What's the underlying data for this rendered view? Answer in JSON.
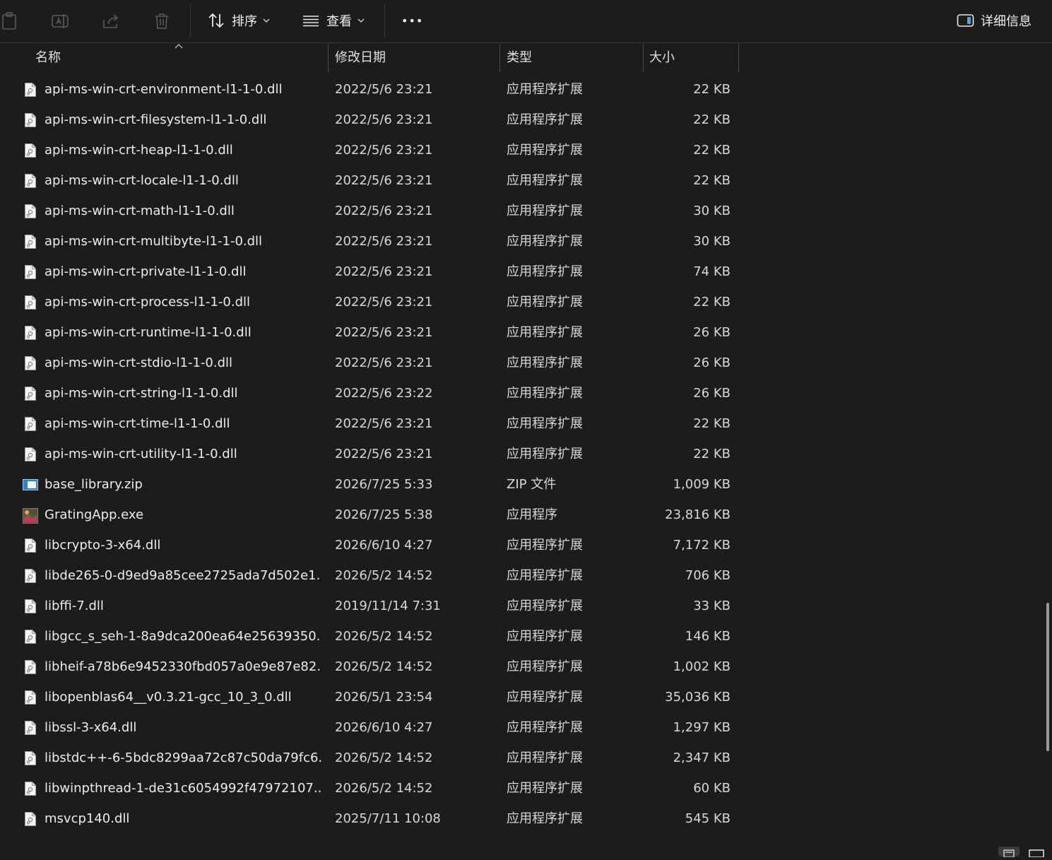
{
  "toolbar": {
    "sort_label": "排序",
    "view_label": "查看",
    "more_label": "•••",
    "details_label": "详细信息"
  },
  "columns": {
    "name": "名称",
    "date": "修改日期",
    "type": "类型",
    "size": "大小"
  },
  "files": [
    {
      "name": "api-ms-win-crt-environment-l1-1-0.dll",
      "date": "2022/5/6 23:21",
      "type": "应用程序扩展",
      "size": "22 KB",
      "icon": "dll-file-icon"
    },
    {
      "name": "api-ms-win-crt-filesystem-l1-1-0.dll",
      "date": "2022/5/6 23:21",
      "type": "应用程序扩展",
      "size": "22 KB",
      "icon": "dll-file-icon"
    },
    {
      "name": "api-ms-win-crt-heap-l1-1-0.dll",
      "date": "2022/5/6 23:21",
      "type": "应用程序扩展",
      "size": "22 KB",
      "icon": "dll-file-icon"
    },
    {
      "name": "api-ms-win-crt-locale-l1-1-0.dll",
      "date": "2022/5/6 23:21",
      "type": "应用程序扩展",
      "size": "22 KB",
      "icon": "dll-file-icon"
    },
    {
      "name": "api-ms-win-crt-math-l1-1-0.dll",
      "date": "2022/5/6 23:21",
      "type": "应用程序扩展",
      "size": "30 KB",
      "icon": "dll-file-icon"
    },
    {
      "name": "api-ms-win-crt-multibyte-l1-1-0.dll",
      "date": "2022/5/6 23:21",
      "type": "应用程序扩展",
      "size": "30 KB",
      "icon": "dll-file-icon"
    },
    {
      "name": "api-ms-win-crt-private-l1-1-0.dll",
      "date": "2022/5/6 23:21",
      "type": "应用程序扩展",
      "size": "74 KB",
      "icon": "dll-file-icon"
    },
    {
      "name": "api-ms-win-crt-process-l1-1-0.dll",
      "date": "2022/5/6 23:21",
      "type": "应用程序扩展",
      "size": "22 KB",
      "icon": "dll-file-icon"
    },
    {
      "name": "api-ms-win-crt-runtime-l1-1-0.dll",
      "date": "2022/5/6 23:21",
      "type": "应用程序扩展",
      "size": "26 KB",
      "icon": "dll-file-icon"
    },
    {
      "name": "api-ms-win-crt-stdio-l1-1-0.dll",
      "date": "2022/5/6 23:21",
      "type": "应用程序扩展",
      "size": "26 KB",
      "icon": "dll-file-icon"
    },
    {
      "name": "api-ms-win-crt-string-l1-1-0.dll",
      "date": "2022/5/6 23:22",
      "type": "应用程序扩展",
      "size": "26 KB",
      "icon": "dll-file-icon"
    },
    {
      "name": "api-ms-win-crt-time-l1-1-0.dll",
      "date": "2022/5/6 23:21",
      "type": "应用程序扩展",
      "size": "22 KB",
      "icon": "dll-file-icon"
    },
    {
      "name": "api-ms-win-crt-utility-l1-1-0.dll",
      "date": "2022/5/6 23:21",
      "type": "应用程序扩展",
      "size": "22 KB",
      "icon": "dll-file-icon"
    },
    {
      "name": "base_library.zip",
      "date": "2026/7/25 5:33",
      "type": "ZIP 文件",
      "size": "1,009 KB",
      "icon": "zip-file-icon"
    },
    {
      "name": "GratingApp.exe",
      "date": "2026/7/25 5:38",
      "type": "应用程序",
      "size": "23,816 KB",
      "icon": "exe-app-icon"
    },
    {
      "name": "libcrypto-3-x64.dll",
      "date": "2026/6/10 4:27",
      "type": "应用程序扩展",
      "size": "7,172 KB",
      "icon": "dll-file-icon"
    },
    {
      "name": "libde265-0-d9ed9a85cee2725ada7d502e1...",
      "date": "2026/5/2 14:52",
      "type": "应用程序扩展",
      "size": "706 KB",
      "icon": "dll-file-icon"
    },
    {
      "name": "libffi-7.dll",
      "date": "2019/11/14 7:31",
      "type": "应用程序扩展",
      "size": "33 KB",
      "icon": "dll-file-icon"
    },
    {
      "name": "libgcc_s_seh-1-8a9dca200ea64e25639350...",
      "date": "2026/5/2 14:52",
      "type": "应用程序扩展",
      "size": "146 KB",
      "icon": "dll-file-icon"
    },
    {
      "name": "libheif-a78b6e9452330fbd057a0e9e87e82...",
      "date": "2026/5/2 14:52",
      "type": "应用程序扩展",
      "size": "1,002 KB",
      "icon": "dll-file-icon"
    },
    {
      "name": "libopenblas64__v0.3.21-gcc_10_3_0.dll",
      "date": "2026/5/1 23:54",
      "type": "应用程序扩展",
      "size": "35,036 KB",
      "icon": "dll-file-icon"
    },
    {
      "name": "libssl-3-x64.dll",
      "date": "2026/6/10 4:27",
      "type": "应用程序扩展",
      "size": "1,297 KB",
      "icon": "dll-file-icon"
    },
    {
      "name": "libstdc++-6-5bdc8299aa72c87c50da79fc6...",
      "date": "2026/5/2 14:52",
      "type": "应用程序扩展",
      "size": "2,347 KB",
      "icon": "dll-file-icon"
    },
    {
      "name": "libwinpthread-1-de31c6054992f47972107...",
      "date": "2026/5/2 14:52",
      "type": "应用程序扩展",
      "size": "60 KB",
      "icon": "dll-file-icon"
    },
    {
      "name": "msvcp140.dll",
      "date": "2025/7/11 10:08",
      "type": "应用程序扩展",
      "size": "545 KB",
      "icon": "dll-file-icon"
    }
  ],
  "colors": {
    "background": "#1c1c1c",
    "text": "#e8e8e8",
    "divider": "#4a4a4a",
    "accent": "#4ea1e6"
  }
}
